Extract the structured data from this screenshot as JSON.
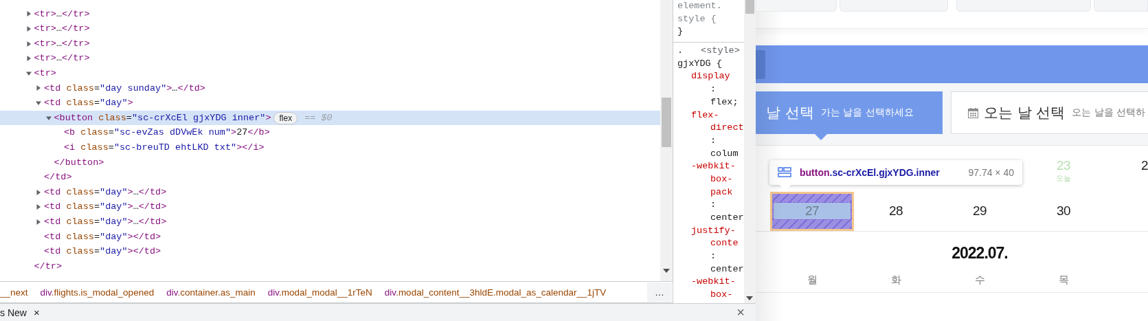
{
  "dom_tree": [
    {
      "selected": false,
      "expanded": false,
      "tokens": [
        {
          "kind": "tag",
          "t": "<tr>"
        },
        {
          "kind": "text",
          "t": "…"
        },
        {
          "kind": "tag",
          "t": "</tr>"
        }
      ]
    },
    {
      "selected": false,
      "expanded": false,
      "tokens": [
        {
          "kind": "tag",
          "t": "<tr>"
        },
        {
          "kind": "text",
          "t": "…"
        },
        {
          "kind": "tag",
          "t": "</tr>"
        }
      ]
    },
    {
      "selected": false,
      "expanded": false,
      "tokens": [
        {
          "kind": "tag",
          "t": "<tr>"
        },
        {
          "kind": "text",
          "t": "…"
        },
        {
          "kind": "tag",
          "t": "</tr>"
        }
      ]
    },
    {
      "selected": false,
      "expanded": false,
      "tokens": [
        {
          "kind": "tag",
          "t": "<tr>"
        },
        {
          "kind": "text",
          "t": "…"
        },
        {
          "kind": "tag",
          "t": "</tr>"
        }
      ]
    },
    {
      "selected": false,
      "expanded": true,
      "tokens": [
        {
          "kind": "tag",
          "t": "<tr>"
        }
      ],
      "close": [
        {
          "kind": "tag",
          "t": "</tr>"
        }
      ],
      "children": [
        {
          "selected": false,
          "expanded": false,
          "tokens": [
            {
              "kind": "tag",
              "t": "<td"
            },
            {
              "kind": "attr",
              "t": " class"
            },
            {
              "kind": "text",
              "t": "="
            },
            {
              "kind": "value",
              "t": "\"day sunday\""
            },
            {
              "kind": "tag",
              "t": ">"
            },
            {
              "kind": "text",
              "t": "…"
            },
            {
              "kind": "tag",
              "t": "</td>"
            }
          ]
        },
        {
          "selected": false,
          "expanded": true,
          "tokens": [
            {
              "kind": "tag",
              "t": "<td"
            },
            {
              "kind": "attr",
              "t": " class"
            },
            {
              "kind": "text",
              "t": "="
            },
            {
              "kind": "value",
              "t": "\"day\""
            },
            {
              "kind": "tag",
              "t": ">"
            }
          ],
          "close": [
            {
              "kind": "tag",
              "t": "</td>"
            }
          ],
          "children": [
            {
              "selected": true,
              "expanded": true,
              "badge": "flex",
              "note": "== $0",
              "tokens": [
                {
                  "kind": "tag",
                  "t": "<button"
                },
                {
                  "kind": "attr",
                  "t": " class"
                },
                {
                  "kind": "text",
                  "t": "="
                },
                {
                  "kind": "value",
                  "t": "\"sc-crXcEl gjxYDG inner\""
                },
                {
                  "kind": "tag",
                  "t": ">"
                }
              ],
              "close": [
                {
                  "kind": "tag",
                  "t": "</button>"
                }
              ],
              "children": [
                {
                  "selected": false,
                  "tokens": [
                    {
                      "kind": "tag",
                      "t": "<b"
                    },
                    {
                      "kind": "attr",
                      "t": " class"
                    },
                    {
                      "kind": "text",
                      "t": "="
                    },
                    {
                      "kind": "value",
                      "t": "\"sc-evZas dDVwEk num\""
                    },
                    {
                      "kind": "tag",
                      "t": ">"
                    },
                    {
                      "kind": "text",
                      "t": "27"
                    },
                    {
                      "kind": "tag",
                      "t": "</b>"
                    }
                  ]
                },
                {
                  "selected": false,
                  "tokens": [
                    {
                      "kind": "tag",
                      "t": "<i"
                    },
                    {
                      "kind": "attr",
                      "t": " class"
                    },
                    {
                      "kind": "text",
                      "t": "="
                    },
                    {
                      "kind": "value",
                      "t": "\"sc-breuTD ehtLKD txt\""
                    },
                    {
                      "kind": "tag",
                      "t": "></i>"
                    }
                  ]
                }
              ]
            }
          ]
        },
        {
          "selected": false,
          "expanded": false,
          "tokens": [
            {
              "kind": "tag",
              "t": "<td"
            },
            {
              "kind": "attr",
              "t": " class"
            },
            {
              "kind": "text",
              "t": "="
            },
            {
              "kind": "value",
              "t": "\"day\""
            },
            {
              "kind": "tag",
              "t": ">"
            },
            {
              "kind": "text",
              "t": "…"
            },
            {
              "kind": "tag",
              "t": "</td>"
            }
          ]
        },
        {
          "selected": false,
          "expanded": false,
          "tokens": [
            {
              "kind": "tag",
              "t": "<td"
            },
            {
              "kind": "attr",
              "t": " class"
            },
            {
              "kind": "text",
              "t": "="
            },
            {
              "kind": "value",
              "t": "\"day\""
            },
            {
              "kind": "tag",
              "t": ">"
            },
            {
              "kind": "text",
              "t": "…"
            },
            {
              "kind": "tag",
              "t": "</td>"
            }
          ]
        },
        {
          "selected": false,
          "expanded": false,
          "tokens": [
            {
              "kind": "tag",
              "t": "<td"
            },
            {
              "kind": "attr",
              "t": " class"
            },
            {
              "kind": "text",
              "t": "="
            },
            {
              "kind": "value",
              "t": "\"day\""
            },
            {
              "kind": "tag",
              "t": ">"
            },
            {
              "kind": "text",
              "t": "…"
            },
            {
              "kind": "tag",
              "t": "</td>"
            }
          ]
        },
        {
          "selected": false,
          "tokens": [
            {
              "kind": "tag",
              "t": "<td"
            },
            {
              "kind": "attr",
              "t": " class"
            },
            {
              "kind": "text",
              "t": "="
            },
            {
              "kind": "value",
              "t": "\"day\""
            },
            {
              "kind": "tag",
              "t": "></td>"
            }
          ]
        },
        {
          "selected": false,
          "tokens": [
            {
              "kind": "tag",
              "t": "<td"
            },
            {
              "kind": "attr",
              "t": " class"
            },
            {
              "kind": "text",
              "t": "="
            },
            {
              "kind": "value",
              "t": "\"day\""
            },
            {
              "kind": "tag",
              "t": "></td>"
            }
          ]
        }
      ]
    }
  ],
  "breadcrumbs": [
    {
      "rest": "__next"
    },
    {
      "tag": "div",
      "rest": ".flights.is_modal_opened"
    },
    {
      "tag": "div",
      "rest": ".container.as_main"
    },
    {
      "tag": "div",
      "rest": ".modal_modal__1rTeN"
    },
    {
      "tag": "div",
      "rest": ".modal_content__3hldE.modal_as_calendar__1jTV"
    }
  ],
  "breadcrumb_more": "…",
  "styles": {
    "element_style": [
      {
        "kind": "dim",
        "text": "element."
      },
      {
        "kind": "dim",
        "text": "style {"
      },
      {
        "kind": "brace",
        "text": "}"
      }
    ],
    "rule_start": ".",
    "rule_source": "<style>",
    "rule_lines": [
      {
        "kind": "selector",
        "text": "gjxYDG {"
      },
      {
        "kind": "prop",
        "text": "display"
      },
      {
        "kind": "colon",
        "text": ":"
      },
      {
        "kind": "value",
        "text": "flex;"
      },
      {
        "kind": "prop",
        "text": "flex-"
      },
      {
        "kind": "prop-cont",
        "text": "direct"
      },
      {
        "kind": "colon",
        "text": ":"
      },
      {
        "kind": "value",
        "text": "colum"
      },
      {
        "kind": "prop",
        "text": "-webkit-"
      },
      {
        "kind": "prop-cont",
        "text": "box-"
      },
      {
        "kind": "prop-cont",
        "text": "pack"
      },
      {
        "kind": "colon",
        "text": ":"
      },
      {
        "kind": "value",
        "text": "center"
      },
      {
        "kind": "prop",
        "text": "justify-"
      },
      {
        "kind": "prop-cont",
        "text": "conte"
      },
      {
        "kind": "colon",
        "text": ":"
      },
      {
        "kind": "value",
        "text": "center"
      },
      {
        "kind": "prop",
        "text": "-webkit-"
      },
      {
        "kind": "prop-cont",
        "text": "box-"
      }
    ]
  },
  "drawer": {
    "tab": "s New",
    "tab_close": "×",
    "close": "×"
  },
  "page": {
    "tabs": [
      {
        "title": "날 선택",
        "subtitle": "가는 날을 선택하세요",
        "selected": true,
        "icon": false
      },
      {
        "title": "오는 날 선택",
        "subtitle": "오는 날을 선택하",
        "selected": false,
        "icon": true
      }
    ],
    "weeks": [
      {
        "days": [
          {
            "day": "23",
            "today": true,
            "inspected": false,
            "label": "오늘"
          },
          {
            "day": "2",
            "today": false,
            "inspected": false
          }
        ]
      },
      {
        "days": [
          {
            "day": "27",
            "today": false,
            "inspected": true
          },
          {
            "day": "28",
            "today": false,
            "inspected": false
          },
          {
            "day": "29",
            "today": false,
            "inspected": false
          },
          {
            "day": "30",
            "today": false,
            "inspected": false
          }
        ]
      }
    ],
    "month": "2022.07.",
    "weekdays": [
      "월",
      "화",
      "수",
      "목"
    ],
    "tooltip": {
      "tag": "button",
      "selector": ".sc-crXcEl.gjxYDG.inner",
      "size": "97.74 × 40"
    }
  }
}
